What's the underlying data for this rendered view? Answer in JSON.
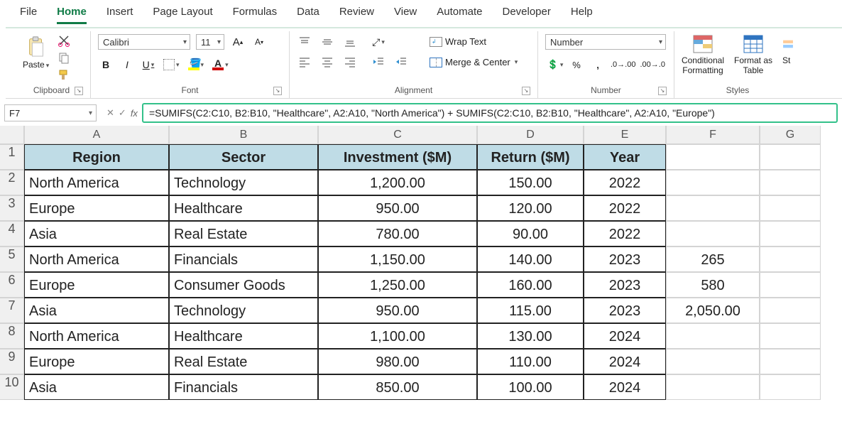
{
  "tabs": {
    "file": "File",
    "home": "Home",
    "insert": "Insert",
    "page_layout": "Page Layout",
    "formulas": "Formulas",
    "data": "Data",
    "review": "Review",
    "view": "View",
    "automate": "Automate",
    "developer": "Developer",
    "help": "Help"
  },
  "ribbon": {
    "clipboard": {
      "label": "Clipboard",
      "paste": "Paste"
    },
    "font": {
      "label": "Font",
      "name": "Calibri",
      "size": "11"
    },
    "alignment": {
      "label": "Alignment",
      "wrap": "Wrap Text",
      "merge": "Merge & Center"
    },
    "number": {
      "label": "Number",
      "format": "Number"
    },
    "styles": {
      "label": "Styles",
      "cond": "Conditional\nFormatting",
      "fmt_table": "Format as\nTable",
      "cell_styles": "St"
    }
  },
  "name_box": "F7",
  "formula": "=SUMIFS(C2:C10, B2:B10, \"Healthcare\", A2:A10, \"North America\") + SUMIFS(C2:C10, B2:B10, \"Healthcare\", A2:A10, \"Europe\")",
  "columns": [
    "A",
    "B",
    "C",
    "D",
    "E",
    "F",
    "G"
  ],
  "headers": {
    "A": "Region",
    "B": "Sector",
    "C": "Investment ($M)",
    "D": "Return ($M)",
    "E": "Year"
  },
  "rows": [
    {
      "n": "2",
      "A": "North America",
      "B": "Technology",
      "C": "1,200.00",
      "D": "150.00",
      "E": "2022",
      "F": "",
      "G": ""
    },
    {
      "n": "3",
      "A": "Europe",
      "B": "Healthcare",
      "C": "950.00",
      "D": "120.00",
      "E": "2022",
      "F": "",
      "G": ""
    },
    {
      "n": "4",
      "A": "Asia",
      "B": "Real Estate",
      "C": "780.00",
      "D": "90.00",
      "E": "2022",
      "F": "",
      "G": ""
    },
    {
      "n": "5",
      "A": "North America",
      "B": "Financials",
      "C": "1,150.00",
      "D": "140.00",
      "E": "2023",
      "F": "265",
      "G": ""
    },
    {
      "n": "6",
      "A": "Europe",
      "B": "Consumer Goods",
      "C": "1,250.00",
      "D": "160.00",
      "E": "2023",
      "F": "580",
      "G": ""
    },
    {
      "n": "7",
      "A": "Asia",
      "B": "Technology",
      "C": "950.00",
      "D": "115.00",
      "E": "2023",
      "F": "2,050.00",
      "G": ""
    },
    {
      "n": "8",
      "A": "North America",
      "B": "Healthcare",
      "C": "1,100.00",
      "D": "130.00",
      "E": "2024",
      "F": "",
      "G": ""
    },
    {
      "n": "9",
      "A": "Europe",
      "B": "Real Estate",
      "C": "980.00",
      "D": "110.00",
      "E": "2024",
      "F": "",
      "G": ""
    },
    {
      "n": "10",
      "A": "Asia",
      "B": "Financials",
      "C": "850.00",
      "D": "100.00",
      "E": "2024",
      "F": "",
      "G": ""
    }
  ]
}
